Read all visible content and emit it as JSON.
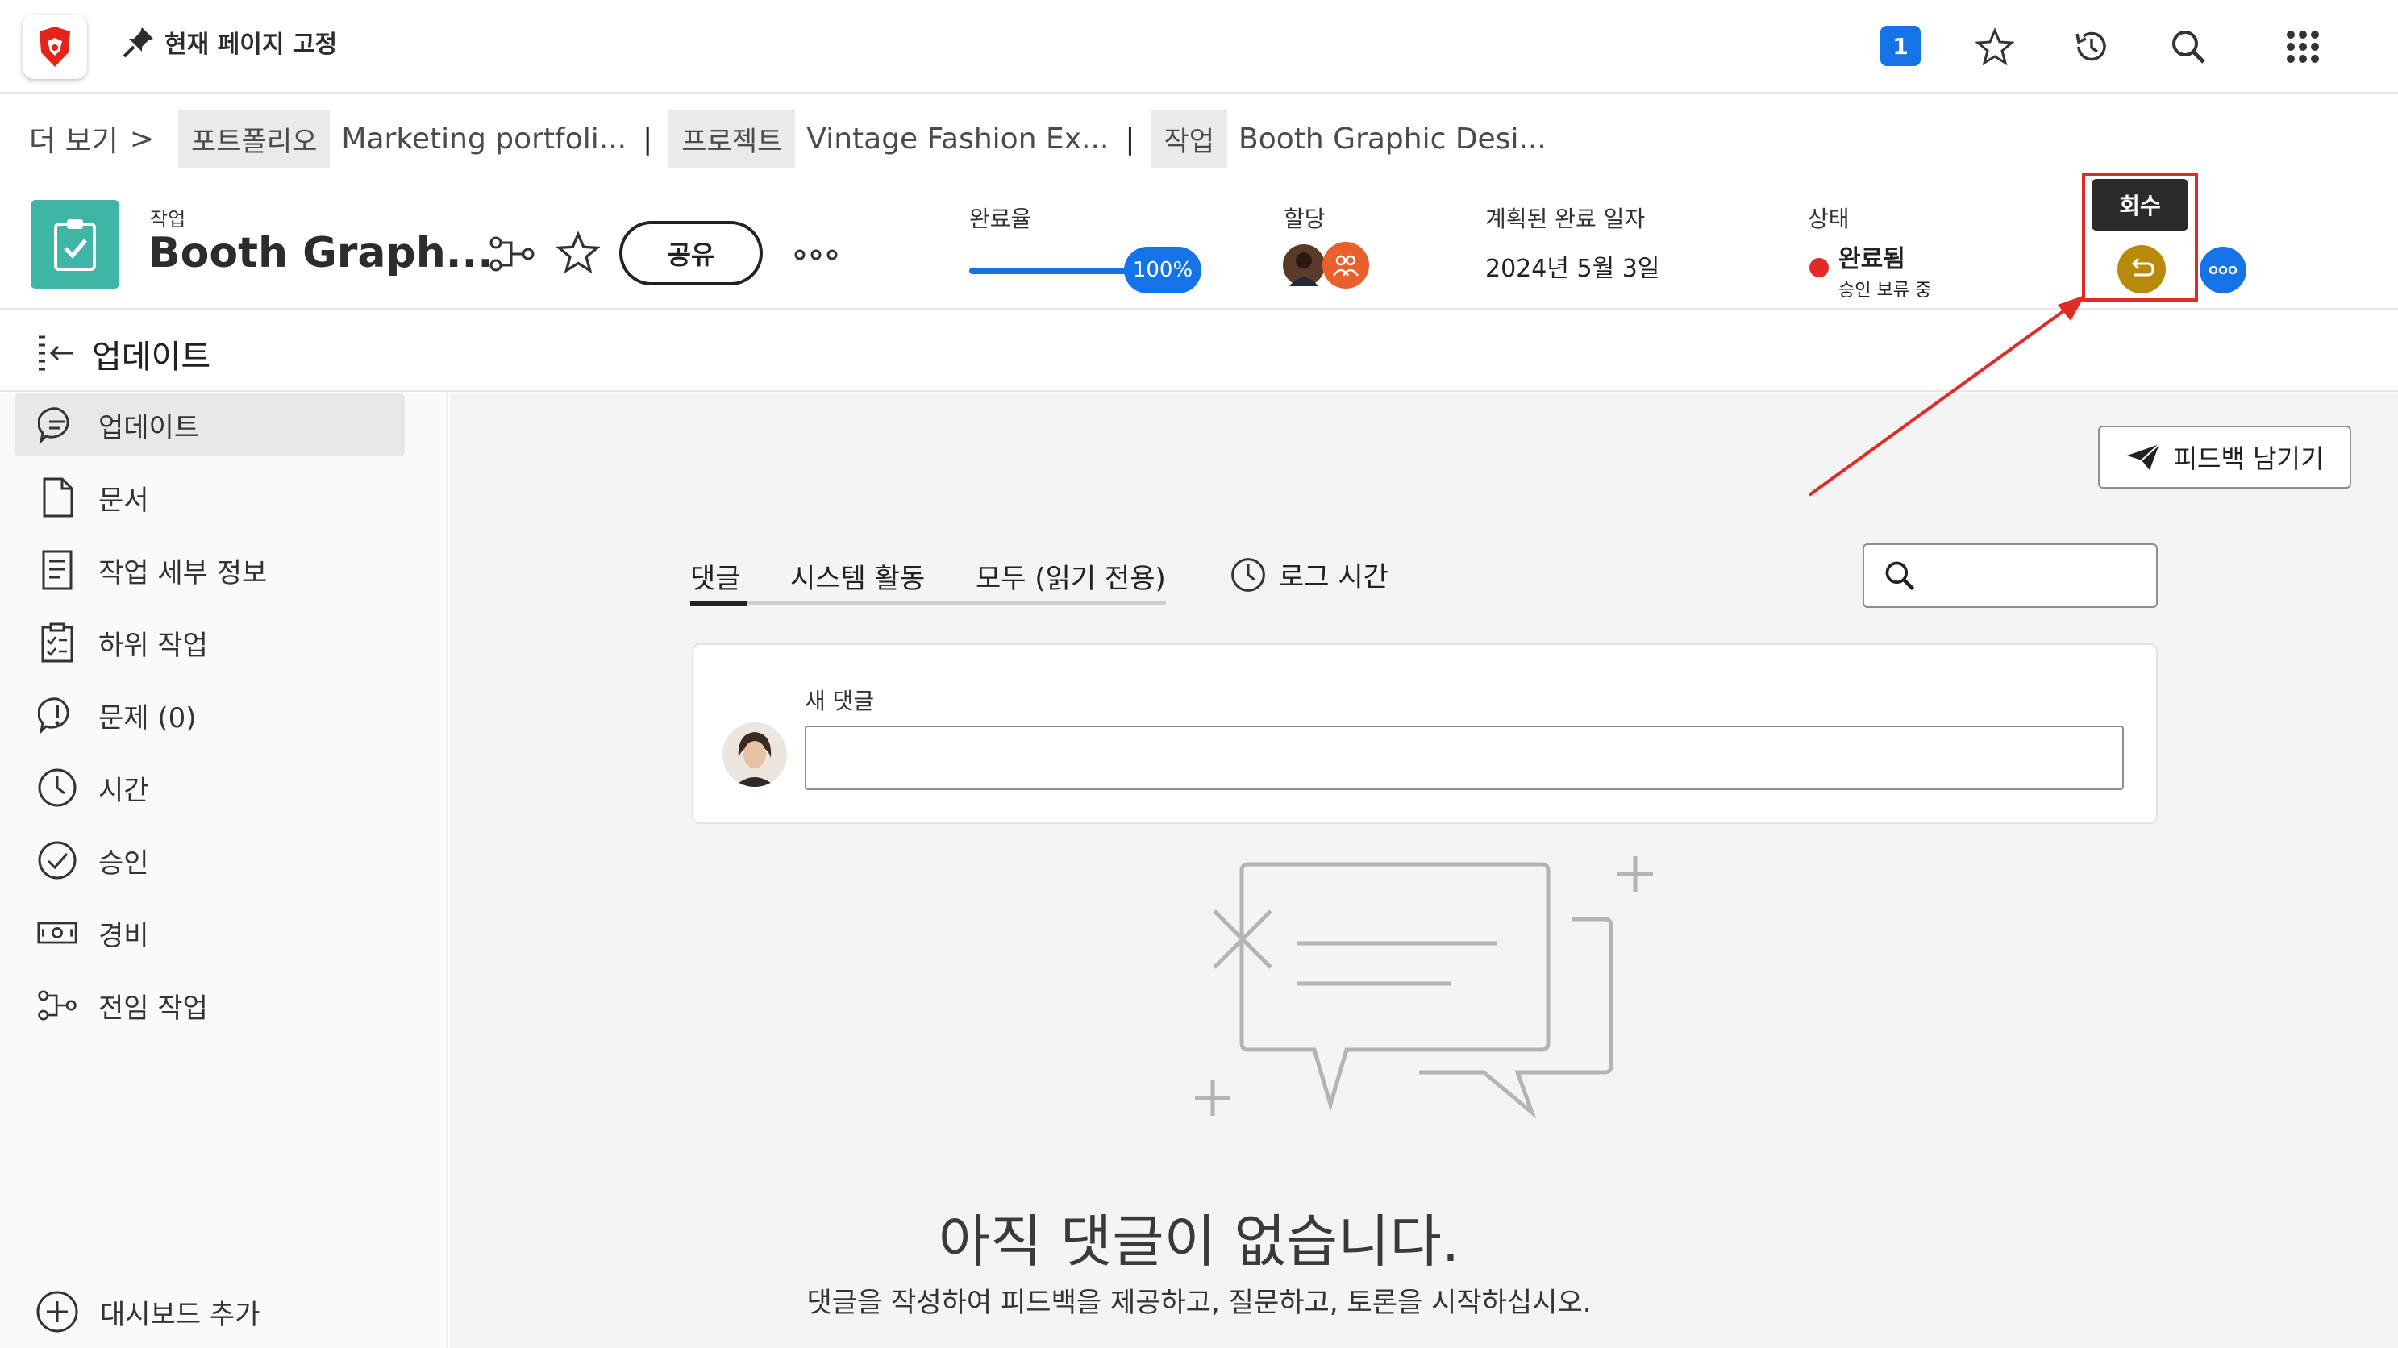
{
  "topbar": {
    "pin_label": "현재 페이지 고정",
    "notification_count": "1",
    "icons": [
      "brave-logo-icon",
      "pin-icon",
      "star-icon",
      "history-icon",
      "search-icon",
      "grid-menu-icon"
    ]
  },
  "breadcrumb": {
    "more": "더 보기",
    "chevron": ">",
    "portfolio_tag": "포트폴리오",
    "portfolio_name": "Marketing portfoli...",
    "sep": "|",
    "project_tag": "프로젝트",
    "project_name": "Vintage Fashion Ex...",
    "task_tag": "작업",
    "task_name": "Booth Graphic Desi..."
  },
  "header": {
    "object_type": "작업",
    "title": "Booth Graph...",
    "share_label": "공유",
    "progress_label": "완료율",
    "progress_value": "100%",
    "progress_fraction": 1.0,
    "assign_label": "할당",
    "planned_label": "계획된 완료 일자",
    "planned_value": "2024년 5월 3일",
    "status_label": "상태",
    "status_value": "완료됨",
    "status_sub": "승인 보류 중",
    "status_color": "#e02b27",
    "tooltip": "회수",
    "accent": "#1473e6",
    "task_color": "#3fb5a8",
    "recall_color": "#b88a0c"
  },
  "updates_header": {
    "title": "업데이트"
  },
  "sidebar": {
    "items": [
      {
        "label": "업데이트",
        "icon": "chat-bubble-icon"
      },
      {
        "label": "문서",
        "icon": "document-icon"
      },
      {
        "label": "작업 세부 정보",
        "icon": "details-icon"
      },
      {
        "label": "하위 작업",
        "icon": "subtask-icon"
      },
      {
        "label": "문제 (0)",
        "icon": "issue-icon"
      },
      {
        "label": "시간",
        "icon": "clock-icon"
      },
      {
        "label": "승인",
        "icon": "approval-icon"
      },
      {
        "label": "경비",
        "icon": "expense-icon"
      },
      {
        "label": "전임 작업",
        "icon": "predecessor-icon"
      }
    ],
    "add_dashboard": "대시보드 추가"
  },
  "main": {
    "feedback_label": "피드백 남기기",
    "tabs": [
      "댓글",
      "시스템 활동",
      "모두 (읽기 전용)"
    ],
    "log_time": "로그 시간",
    "new_comment_label": "새 댓글",
    "empty_title": "아직 댓글이 없습니다.",
    "empty_sub": "댓글을 작성하여 피드백을 제공하고, 질문하고, 토론을 시작하십시오."
  }
}
